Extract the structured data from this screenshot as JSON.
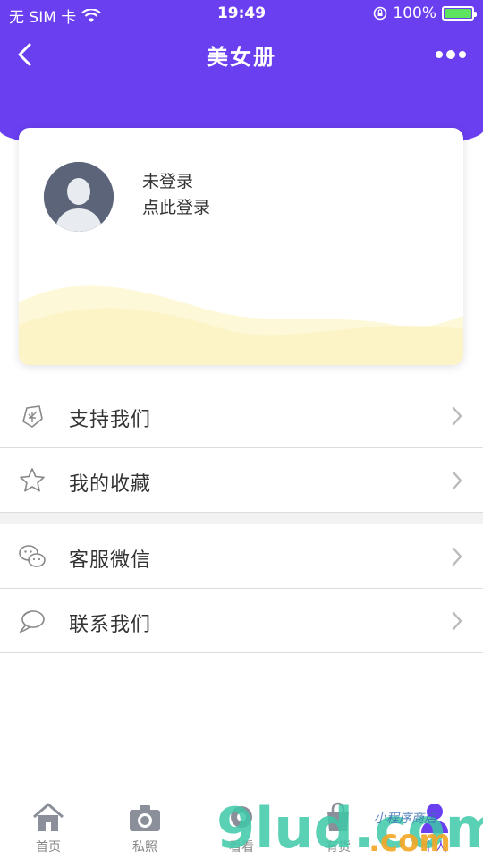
{
  "status": {
    "carrier": "无 SIM 卡",
    "time": "19:49",
    "battery": "100%"
  },
  "nav": {
    "title": "美女册"
  },
  "profile": {
    "line1": "未登录",
    "line2": "点此登录"
  },
  "menu": {
    "items": [
      {
        "label": "支持我们",
        "icon": "tip-icon"
      },
      {
        "label": "我的收藏",
        "icon": "star-icon"
      },
      {
        "label": "客服微信",
        "icon": "wechat-icon"
      },
      {
        "label": "联系我们",
        "icon": "chat-bubble-icon"
      }
    ]
  },
  "tabs": [
    {
      "label": "首页",
      "icon": "home-icon"
    },
    {
      "label": "私照",
      "icon": "camera-icon"
    },
    {
      "label": "看看",
      "icon": "eye-icon"
    },
    {
      "label": "有货",
      "icon": "bag-icon"
    },
    {
      "label": "个人",
      "icon": "person-icon"
    }
  ],
  "watermark": {
    "text": "9lud.com",
    "subtext": "小程序商店"
  },
  "colors": {
    "primary": "#6a3ff0",
    "wave": "#fdf6c9",
    "avatar": "#5b6478"
  }
}
